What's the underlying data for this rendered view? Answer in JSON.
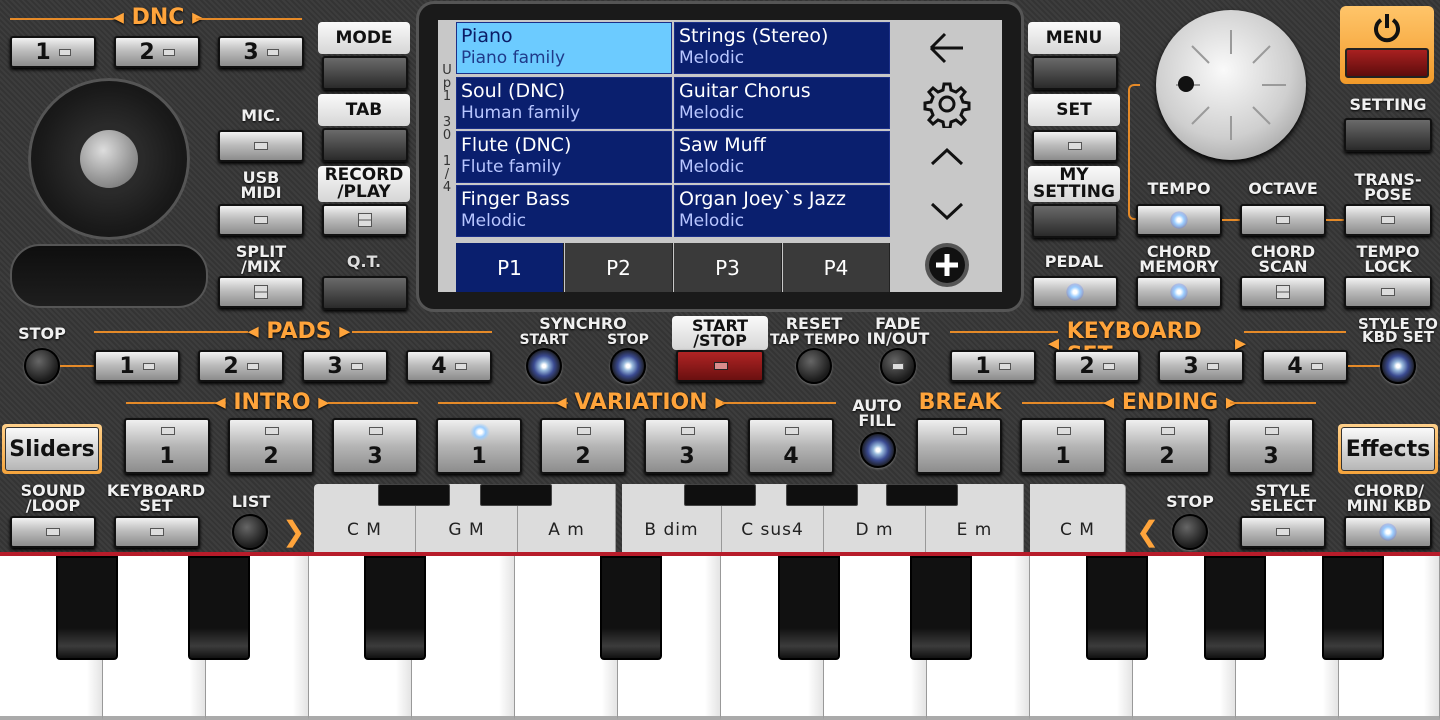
{
  "dnc": {
    "title": "DNC",
    "buttons": [
      "1",
      "2",
      "3"
    ]
  },
  "left": {
    "mic": "MIC.",
    "usb_midi": "USB\nMIDI",
    "split_mix": "SPLIT\n/MIX"
  },
  "side_tabs": {
    "mode": "MODE",
    "tab": "TAB",
    "record_play": "RECORD\n/PLAY",
    "qt": "Q.T."
  },
  "right_tabs": {
    "menu": "MENU",
    "set": "SET",
    "my_setting": "MY\nSETTING",
    "pedal": "PEDAL"
  },
  "display": {
    "vstrip": "U\np\n1\n\n3\n0\n\n1\n/\n4",
    "voices": [
      {
        "name": "Piano",
        "family": "Piano family",
        "selected": true
      },
      {
        "name": "Strings (Stereo)",
        "family": "Melodic"
      },
      {
        "name": "Soul (DNC)",
        "family": "Human family"
      },
      {
        "name": "Guitar Chorus",
        "family": "Melodic"
      },
      {
        "name": "Flute (DNC)",
        "family": "Flute family"
      },
      {
        "name": "Saw Muff",
        "family": "Melodic"
      },
      {
        "name": "Finger Bass",
        "family": "Melodic"
      },
      {
        "name": "Organ Joey`s Jazz",
        "family": "Melodic"
      }
    ],
    "pages": [
      "P1",
      "P2",
      "P3",
      "P4"
    ],
    "selected_page": "P1",
    "icons": [
      "back-arrow-icon",
      "gear-icon",
      "chevron-up-icon",
      "chevron-down-icon",
      "plus-circle-icon"
    ]
  },
  "right": {
    "setting": "SETTING",
    "tempo": "TEMPO",
    "octave": "OCTAVE",
    "transpose": "TRANS-\nPOSE",
    "chord_memory": "CHORD\nMEMORY",
    "chord_scan": "CHORD\nSCAN",
    "tempo_lock": "TEMPO\nLOCK",
    "power_icon": "power-icon"
  },
  "row2": {
    "stop": "STOP",
    "pads": "PADS",
    "pad_buttons": [
      "1",
      "2",
      "3",
      "4"
    ],
    "synchro": "SYNCHRO",
    "synchro_start": "START",
    "synchro_stop": "STOP",
    "start_stop": "START\n/STOP",
    "reset": "RESET",
    "tap_tempo": "TAP TEMPO",
    "fade": "FADE\nIN/OUT",
    "keyboard_set": "KEYBOARD SET",
    "kbd_buttons": [
      "1",
      "2",
      "3",
      "4"
    ],
    "style_to_kbd": "STYLE TO\nKBD SET"
  },
  "row3": {
    "sliders": "Sliders",
    "effects": "Effects",
    "intro": "INTRO",
    "variation": "VARIATION",
    "break": "BREAK",
    "ending": "ENDING",
    "auto_fill": "AUTO\nFILL",
    "intro_buttons": [
      "1",
      "2",
      "3"
    ],
    "variation_buttons": [
      "1",
      "2",
      "3",
      "4"
    ],
    "ending_buttons": [
      "1",
      "2",
      "3"
    ]
  },
  "row4": {
    "sound_loop": "SOUND\n/LOOP",
    "keyboard_set": "KEYBOARD\nSET",
    "list": "LIST",
    "stop": "STOP",
    "style_select": "STYLE\nSELECT",
    "chord_mini_kbd": "CHORD/\nMINI KBD",
    "chords": [
      "C M",
      "G M",
      "A m",
      "B dim",
      "C sus4",
      "D m",
      "E m",
      "C M"
    ]
  },
  "colors": {
    "accent": "#ffa43b",
    "display_bg": "#0a1f6e",
    "selected_cell": "#6ccbff",
    "start_stop": "#8e1a1a"
  }
}
